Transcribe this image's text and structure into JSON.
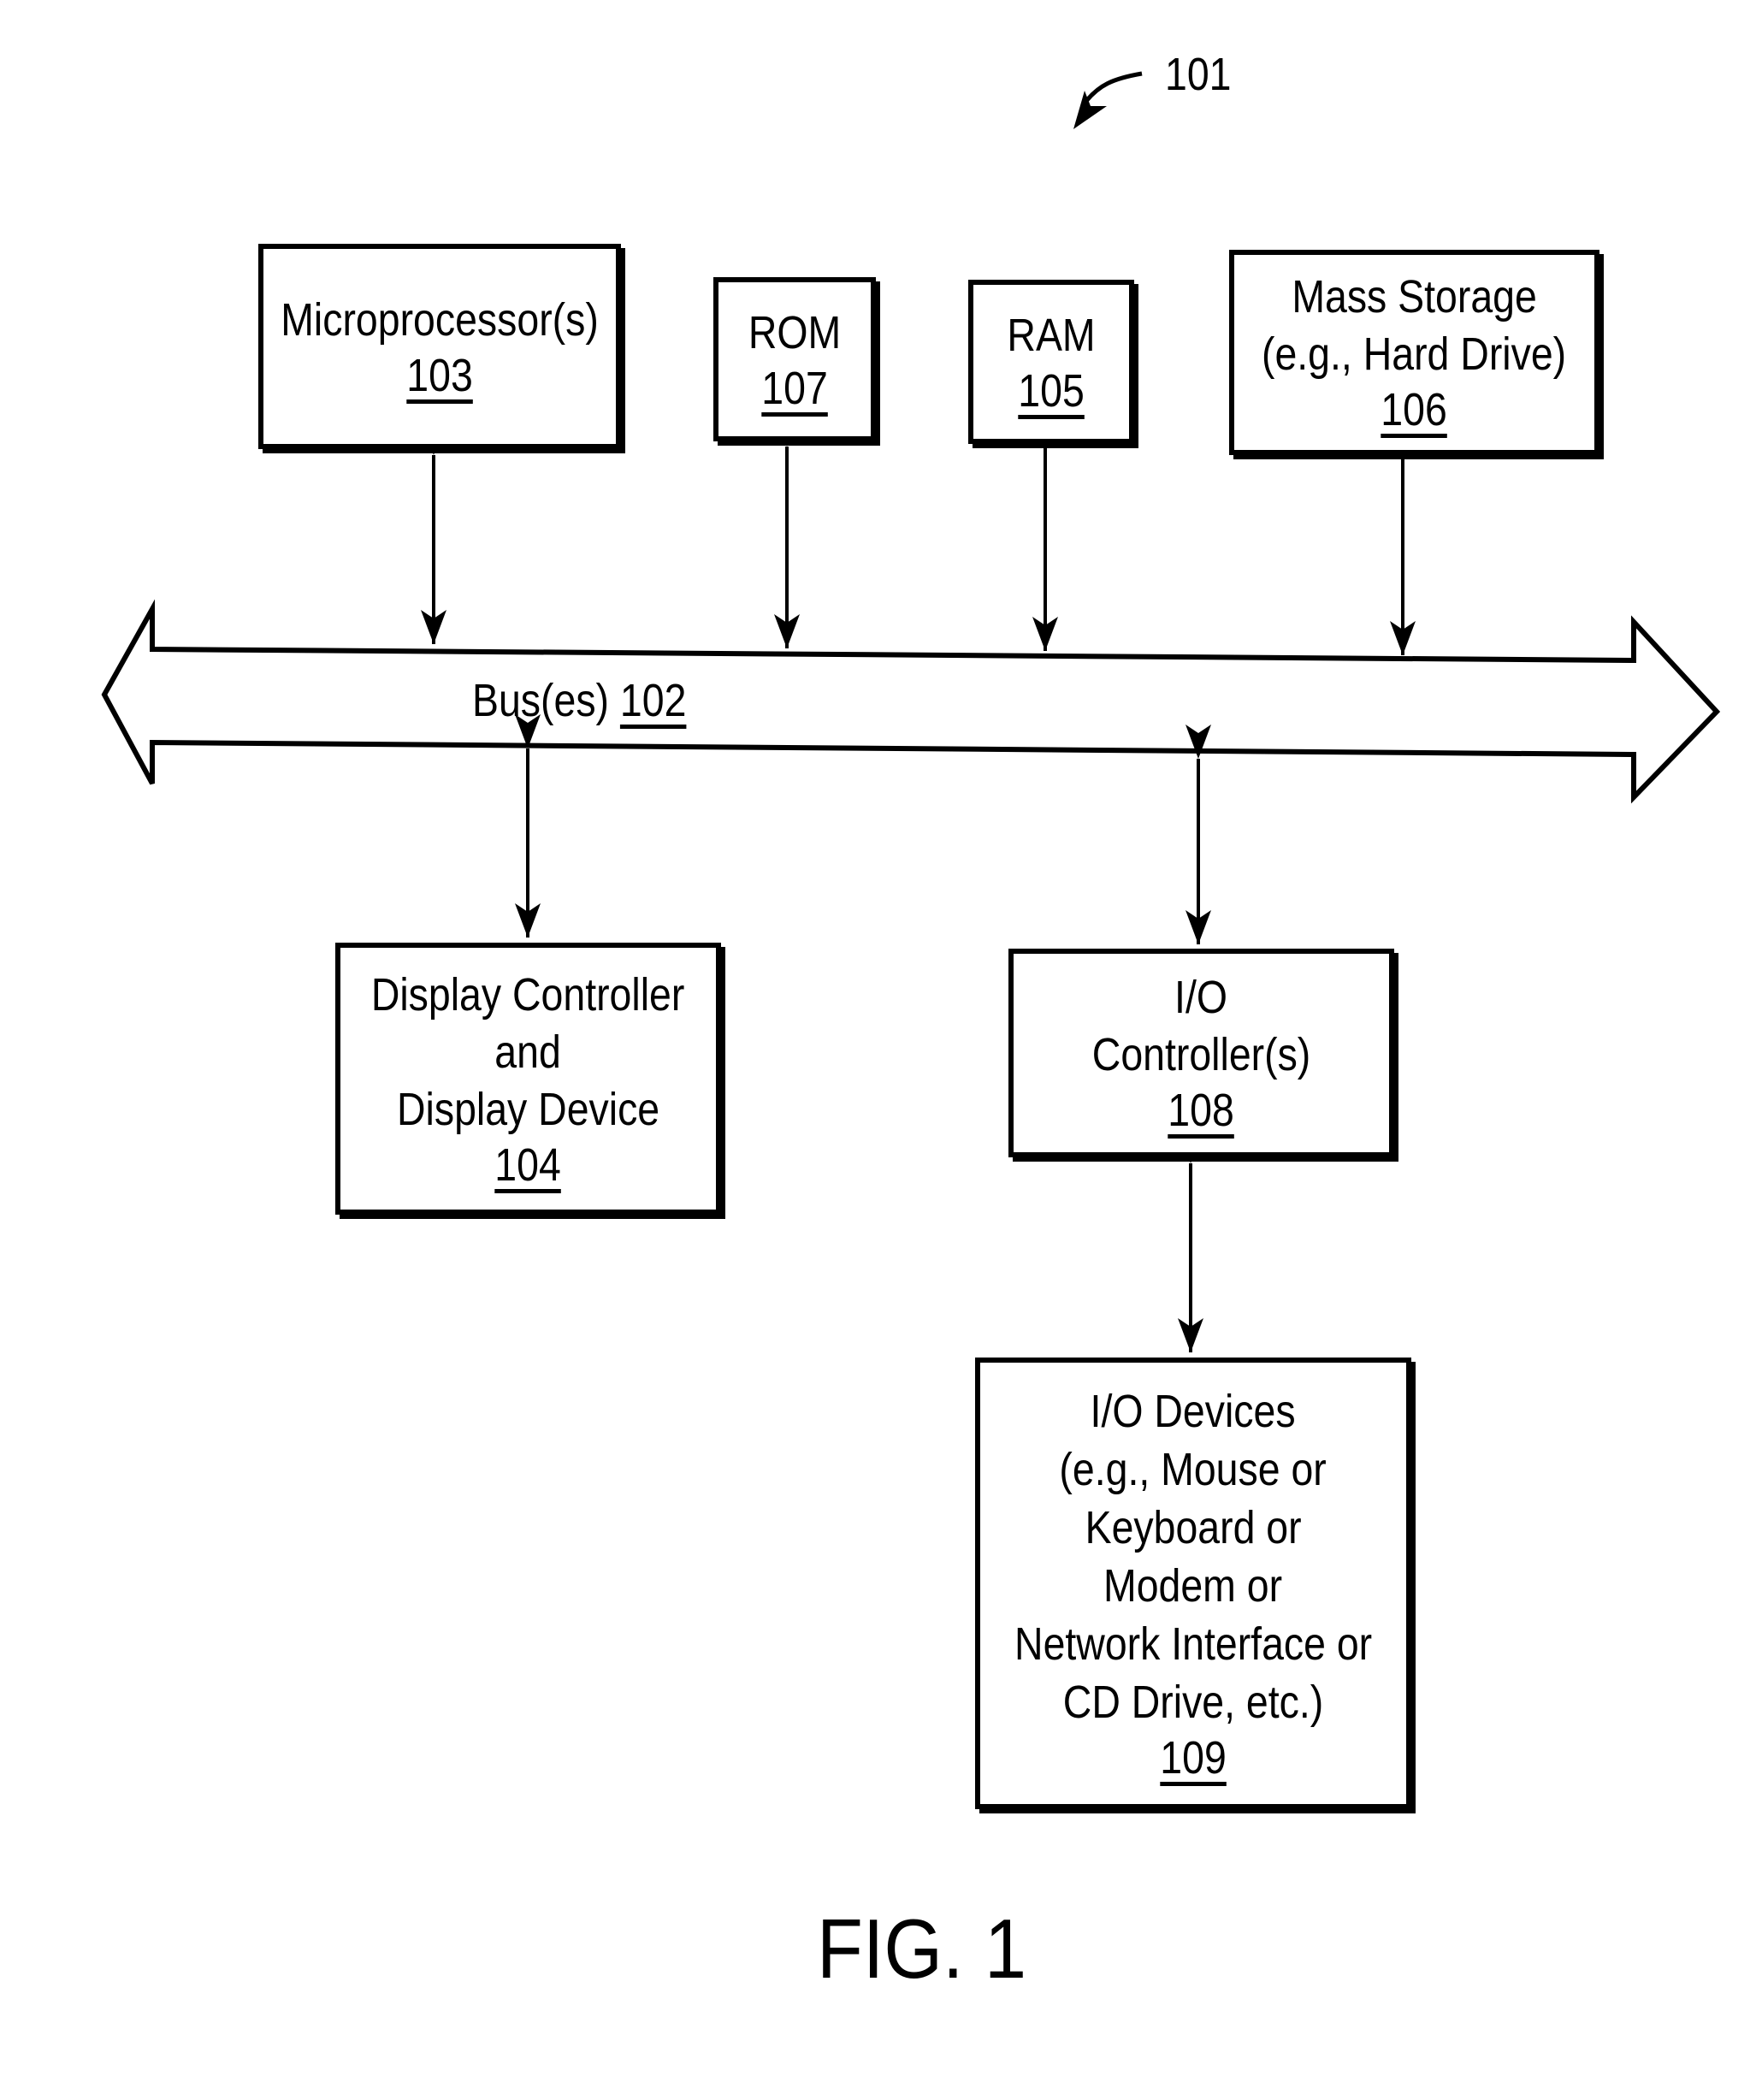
{
  "figure": {
    "caption": "FIG. 1",
    "reference": "101"
  },
  "bus": {
    "label": "Bus(es)",
    "ref": "102"
  },
  "blocks": {
    "microprocessor": {
      "lines": [
        "Microprocessor(s)"
      ],
      "ref": "103"
    },
    "rom": {
      "lines": [
        "ROM"
      ],
      "ref": "107"
    },
    "ram": {
      "lines": [
        "RAM"
      ],
      "ref": "105"
    },
    "mass_storage": {
      "lines": [
        "Mass Storage",
        "(e.g., Hard Drive)"
      ],
      "ref": "106"
    },
    "display": {
      "lines": [
        "Display Controller",
        "and",
        "Display Device"
      ],
      "ref": "104"
    },
    "io_controller": {
      "lines": [
        "I/O",
        "Controller(s)"
      ],
      "ref": "108"
    },
    "io_devices": {
      "lines": [
        "I/O Devices",
        "(e.g., Mouse  or",
        "Keyboard or",
        "Modem or",
        "Network Interface or",
        "CD Drive, etc.)"
      ],
      "ref": "109"
    }
  },
  "connections": [
    {
      "from": "microprocessor",
      "to": "bus",
      "type": "bidirectional"
    },
    {
      "from": "rom",
      "to": "bus",
      "type": "bidirectional"
    },
    {
      "from": "ram",
      "to": "bus",
      "type": "bidirectional"
    },
    {
      "from": "mass_storage",
      "to": "bus",
      "type": "bidirectional"
    },
    {
      "from": "bus",
      "to": "display",
      "type": "bidirectional"
    },
    {
      "from": "bus",
      "to": "io_controller",
      "type": "bidirectional"
    },
    {
      "from": "io_controller",
      "to": "io_devices",
      "type": "bidirectional"
    }
  ]
}
